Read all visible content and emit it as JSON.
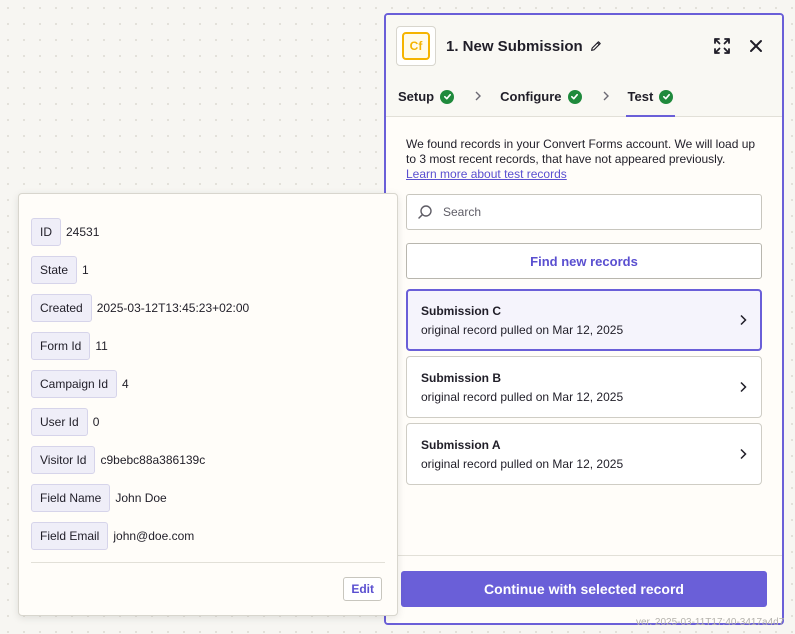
{
  "colors": {
    "accent": "#6a5fd8",
    "success": "#1f8a3c",
    "app_brand": "#f5b400"
  },
  "header": {
    "app_logo_text": "Cf",
    "title": "1. New Submission",
    "icons": [
      "edit-pencil-icon",
      "expand-icon",
      "close-icon"
    ]
  },
  "tabs": [
    {
      "label": "Setup",
      "status": "complete"
    },
    {
      "label": "Configure",
      "status": "complete"
    },
    {
      "label": "Test",
      "status": "complete",
      "active": true
    }
  ],
  "test": {
    "intro": "We found records in your Convert Forms account. We will load up to 3 most recent records, that have not appeared previously.",
    "learn_more": "Learn more about test records",
    "search_placeholder": "Search",
    "find_button": "Find new records",
    "records": [
      {
        "name": "Submission C",
        "subtitle": "original record pulled on Mar 12, 2025",
        "selected": true
      },
      {
        "name": "Submission B",
        "subtitle": "original record pulled on Mar 12, 2025",
        "selected": false
      },
      {
        "name": "Submission A",
        "subtitle": "original record pulled on Mar 12, 2025",
        "selected": false
      }
    ],
    "continue_button": "Continue with selected record"
  },
  "version_text": "ver. 2025-03-11T17:40-3417a4d7",
  "record_details": {
    "fields": [
      {
        "key": "ID",
        "value": "24531"
      },
      {
        "key": "State",
        "value": "1"
      },
      {
        "key": "Created",
        "value": "2025-03-12T13:45:23+02:00"
      },
      {
        "key": "Form Id",
        "value": "11"
      },
      {
        "key": "Campaign Id",
        "value": "4"
      },
      {
        "key": "User Id",
        "value": "0"
      },
      {
        "key": "Visitor Id",
        "value": "c9bebc88a386139c"
      },
      {
        "key": "Field Name",
        "value": "John Doe"
      },
      {
        "key": "Field Email",
        "value": "john@doe.com"
      }
    ],
    "edit_button": "Edit"
  }
}
